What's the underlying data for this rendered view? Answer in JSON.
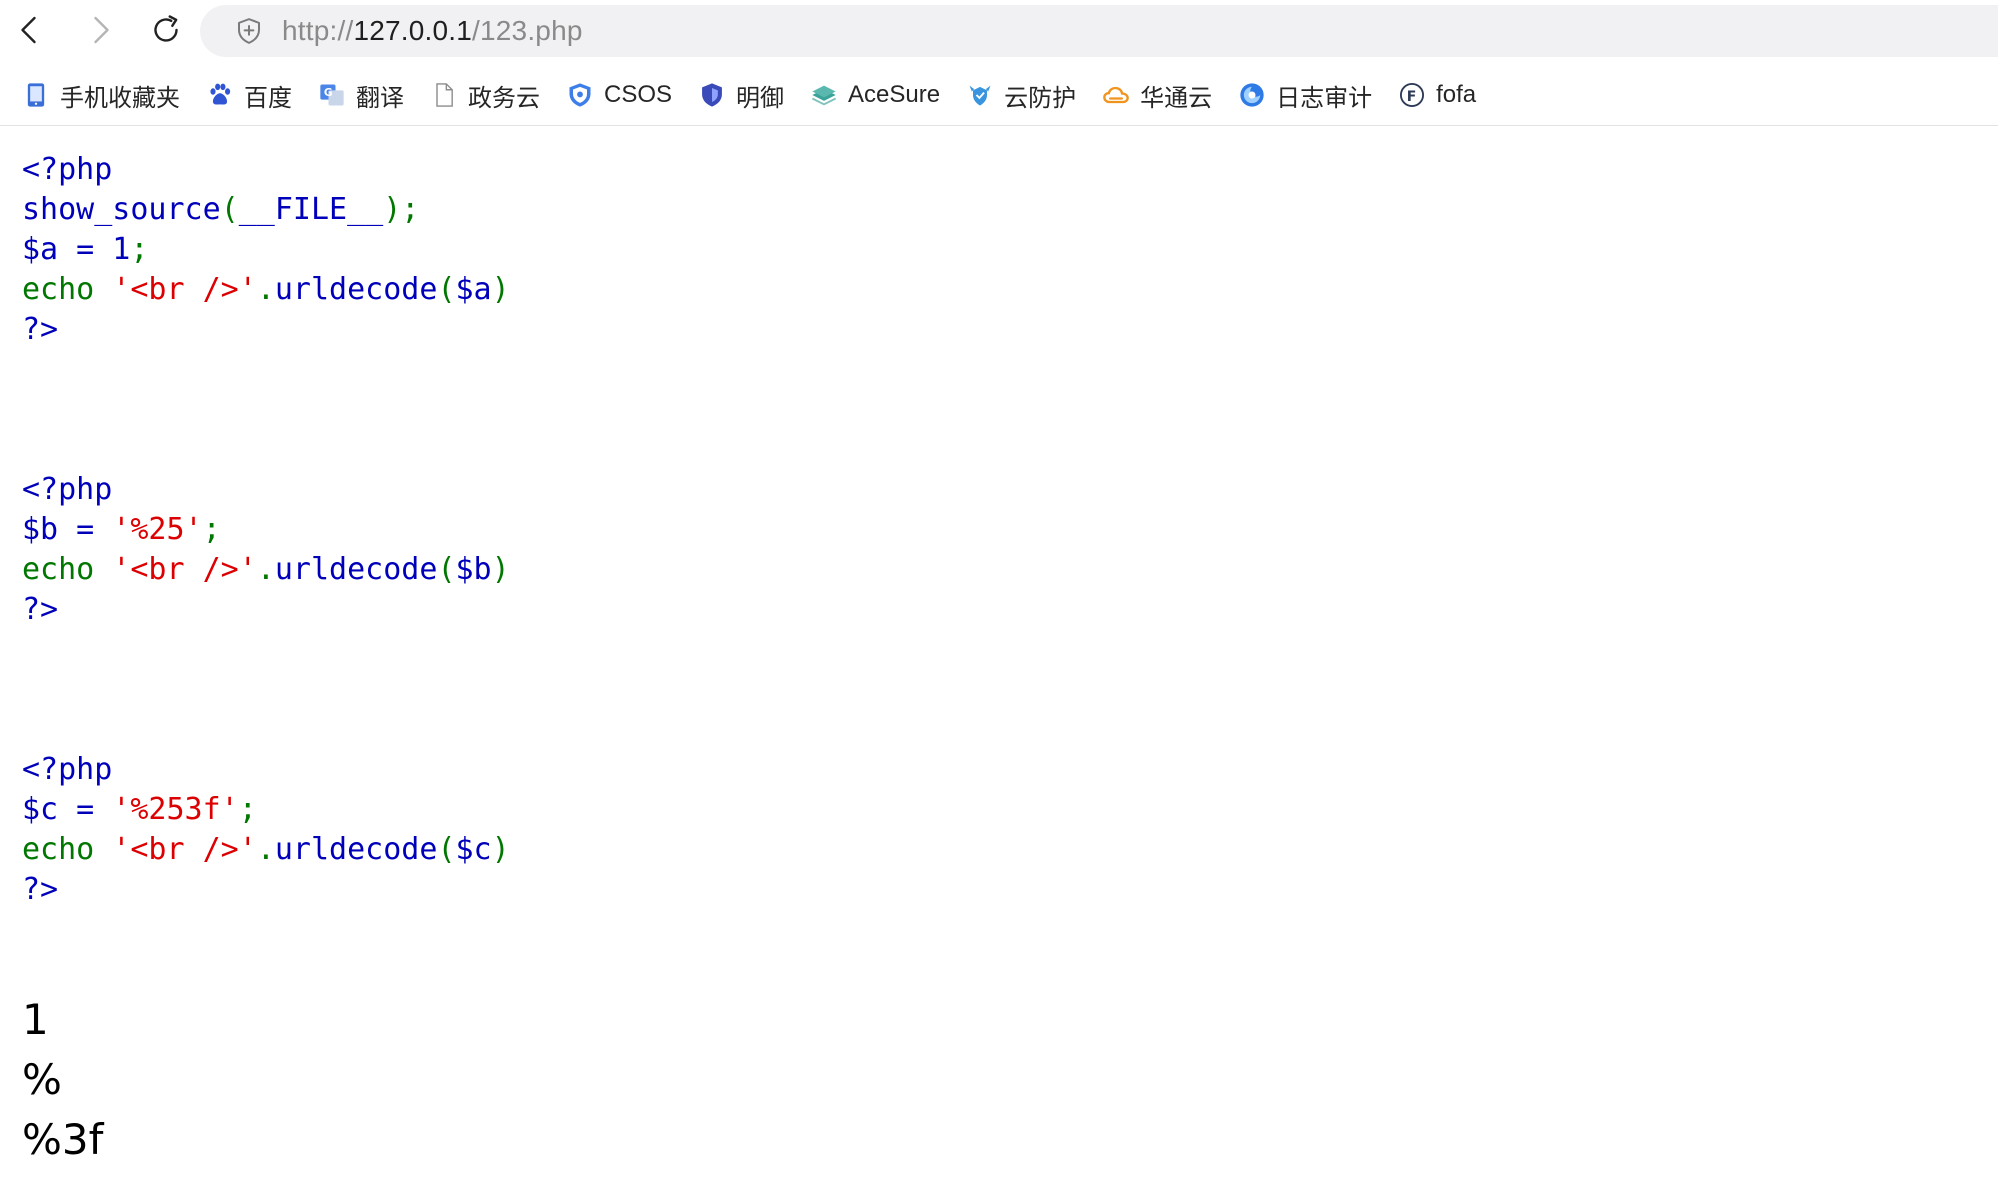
{
  "toolbar": {
    "url_scheme": "http://",
    "url_host": "127.0.0.1",
    "url_path": "/123.php"
  },
  "bookmarks": [
    {
      "label": "手机收藏夹",
      "icon": "phone-bookmark-icon"
    },
    {
      "label": "百度",
      "icon": "baidu-paw-icon"
    },
    {
      "label": "翻译",
      "icon": "translate-icon"
    },
    {
      "label": "政务云",
      "icon": "document-icon"
    },
    {
      "label": "CSOS",
      "icon": "csos-shield-icon"
    },
    {
      "label": "明御",
      "icon": "mingyu-shield-icon"
    },
    {
      "label": "AceSure",
      "icon": "acesure-layers-icon"
    },
    {
      "label": "云防护",
      "icon": "cloud-protect-icon"
    },
    {
      "label": "华通云",
      "icon": "cloud-icon"
    },
    {
      "label": "日志审计",
      "icon": "log-audit-icon"
    },
    {
      "label": "fofa",
      "icon": "fofa-icon"
    }
  ],
  "source": {
    "block1": {
      "open": "<?php",
      "l2_func": "show_source",
      "l2_p1": "(",
      "l2_const": "__FILE__",
      "l2_p2": ");",
      "l3_var": "$a = 1",
      "l3_semi": ";",
      "l4_kw": "echo ",
      "l4_str": "'<br />'",
      "l4_dot": ".",
      "l4_func": "urldecode",
      "l4_p1": "(",
      "l4_arg": "$a",
      "l4_p2": ")",
      "close": "?>"
    },
    "block2": {
      "open": "<?php",
      "l2_var": "$b = ",
      "l2_str": "'%25'",
      "l2_semi": ";",
      "l3_kw": "echo ",
      "l3_str": "'<br />'",
      "l3_dot": ".",
      "l3_func": "urldecode",
      "l3_p1": "(",
      "l3_arg": "$b",
      "l3_p2": ")",
      "close": "?>"
    },
    "block3": {
      "open": "<?php",
      "l2_var": "$c = ",
      "l2_str": "'%253f'",
      "l2_semi": ";",
      "l3_kw": "echo ",
      "l3_str": "'<br />'",
      "l3_dot": ".",
      "l3_func": "urldecode",
      "l3_p1": "(",
      "l3_arg": "$c",
      "l3_p2": ")",
      "close": "?>"
    }
  },
  "output": [
    "1",
    "%",
    "%3f"
  ],
  "colors": {
    "php_default": "#0000bb",
    "php_keyword": "#007700",
    "php_string": "#dd0000"
  }
}
